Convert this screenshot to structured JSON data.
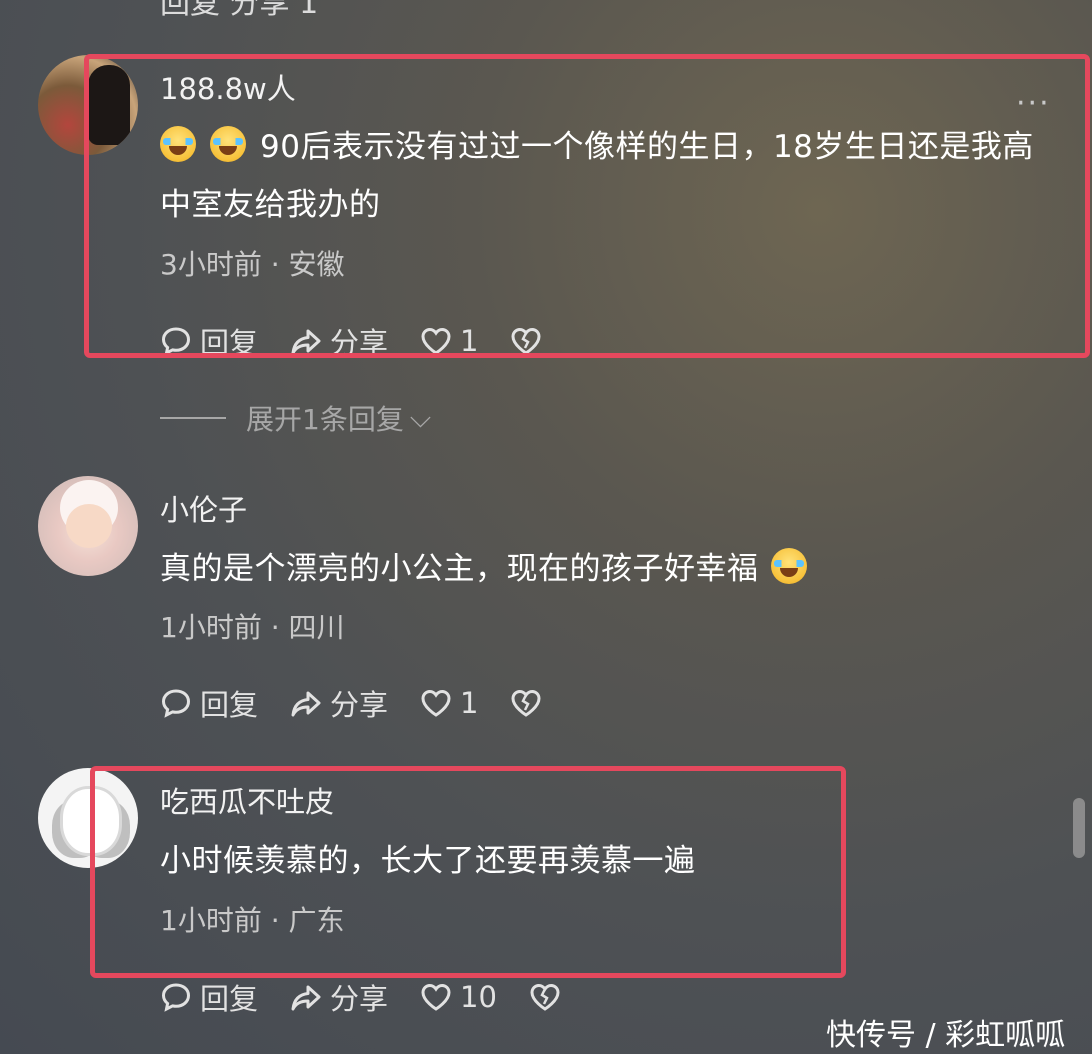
{
  "top_partial_text": "回复   分享   1",
  "comments": [
    {
      "username": "188.8w人",
      "text": "90后表示没有过过一个像样的生日，18岁生日还是我高中室友给我办的",
      "meta": "3小时前 · 安徽",
      "reply_label": "回复",
      "share_label": "分享",
      "like_count": "1",
      "highlighted": true
    },
    {
      "username": "小伦子",
      "text": "真的是个漂亮的小公主，现在的孩子好幸福",
      "meta": "1小时前 · 四川",
      "reply_label": "回复",
      "share_label": "分享",
      "like_count": "1",
      "highlighted": false
    },
    {
      "username": "吃西瓜不吐皮",
      "text": "小时候羡慕的，长大了还要再羡慕一遍",
      "meta": "1小时前 · 广东",
      "reply_label": "回复",
      "share_label": "分享",
      "like_count": "10",
      "highlighted": true
    }
  ],
  "expand_replies": "展开1条回复",
  "more_icon": "more-dots-icon",
  "watermark": "快传号 / 彩虹呱呱",
  "colors": {
    "highlight": "#e5485d",
    "meta": "#c9c9c9"
  }
}
